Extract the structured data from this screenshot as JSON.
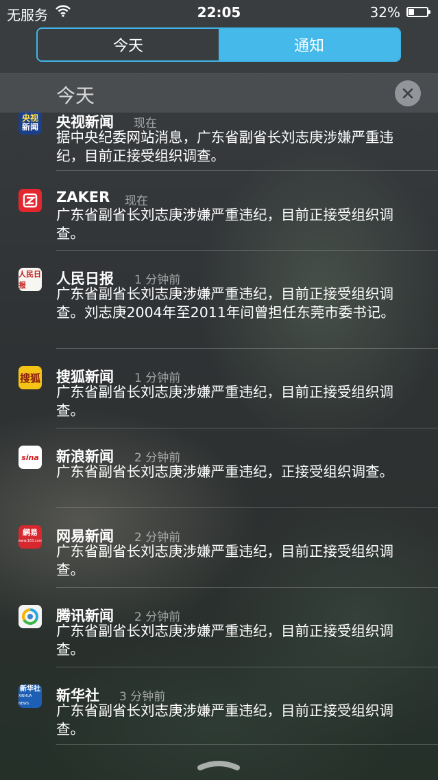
{
  "status_bar": {
    "carrier": "无服务",
    "time": "22:05",
    "battery_pct": "32%",
    "battery_level": 0.32
  },
  "tabs": [
    {
      "label": "今天",
      "active": false
    },
    {
      "label": "通知",
      "active": true
    }
  ],
  "section": {
    "title": "今天"
  },
  "notifications": [
    {
      "icon": "cctv-news-icon",
      "app": "央视新闻",
      "time": "现在",
      "body": "据中央纪委网站消息，广东省副省长刘志庚涉嫌严重违纪，目前正接受组织调查。"
    },
    {
      "icon": "zaker-icon",
      "app": "ZAKER",
      "time": "现在",
      "body": "广东省副省长刘志庚涉嫌严重违纪，目前正接受组织调查。"
    },
    {
      "icon": "peoples-daily-icon",
      "app": "人民日报",
      "time": "1 分钟前",
      "body": "广东省副省长刘志庚涉嫌严重违纪，目前正接受组织调查。刘志庚2004年至2011年间曾担任东莞市委书记。"
    },
    {
      "icon": "sohu-news-icon",
      "app": "搜狐新闻",
      "time": "1 分钟前",
      "body": "广东省副省长刘志庚涉嫌严重违纪，目前正接受组织调查。"
    },
    {
      "icon": "sina-news-icon",
      "app": "新浪新闻",
      "time": "2 分钟前",
      "body": "广东省副省长刘志庚涉嫌严重违纪，正接受组织调查。"
    },
    {
      "icon": "netease-news-icon",
      "app": "网易新闻",
      "time": "2 分钟前",
      "body": "广东省副省长刘志庚涉嫌严重违纪，目前正接受组织调查。"
    },
    {
      "icon": "tencent-news-icon",
      "app": "腾讯新闻",
      "time": "2 分钟前",
      "body": "广东省副省长刘志庚涉嫌严重违纪，目前正接受组织调查。"
    },
    {
      "icon": "xinhua-icon",
      "app": "新华社",
      "time": "3 分钟前",
      "body": "广东省副省长刘志庚涉嫌严重违纪，目前正接受组织调查。"
    }
  ],
  "icon_text": {
    "cctv_top": "央视",
    "cctv_bottom": "新闻",
    "people": "人民日报",
    "sohu": "搜狐",
    "sina": "sina",
    "netease": "網易",
    "netease_sub": "www.163.com",
    "xinhua": "新华社",
    "xinhua_sub": "XINHUA NEWS"
  },
  "colors": {
    "accent": "#45b9ea",
    "zaker": "#e3272f",
    "cctv": "#1c3f8a",
    "netease": "#d7282f",
    "xinhua": "#1e5fb6"
  }
}
